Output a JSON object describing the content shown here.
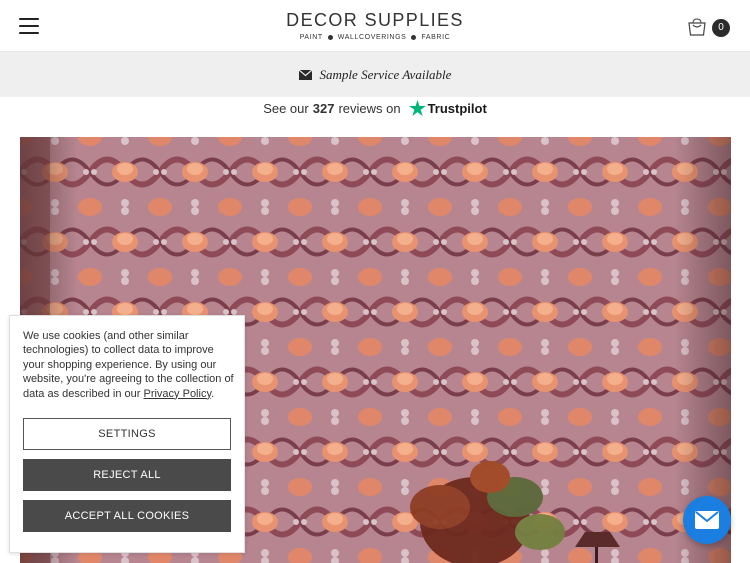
{
  "header": {
    "logo_main": "DECOR SUPPLIES",
    "logo_sub": [
      "PAINT",
      "WALLCOVERINGS",
      "FABRIC"
    ],
    "cart_count": "0",
    "menu_icon": "hamburger-icon",
    "cart_icon": "shopping-bag-icon"
  },
  "sample_bar": {
    "icon": "envelope-icon",
    "text": "Sample Service Available"
  },
  "trustpilot": {
    "prefix": "See our",
    "count": "327",
    "suffix": "reviews on",
    "brand": "Trustpilot",
    "star_color": "#00b67a"
  },
  "cookie": {
    "message": "We use cookies (and other similar technologies) to collect data to improve your shopping experience. By using our website, you're agreeing to the collection of data as described in our",
    "link": "Privacy Policy",
    "after_link": ".",
    "settings_label": "SETTINGS",
    "reject_label": "REJECT ALL",
    "accept_label": "ACCEPT ALL COOKIES"
  },
  "chat": {
    "icon": "envelope-icon",
    "color": "#1a7fe0"
  },
  "colors": {
    "wallpaper_bg": "#b98994",
    "flower": "#e58f6d",
    "button_dark": "#4a4a4a"
  }
}
